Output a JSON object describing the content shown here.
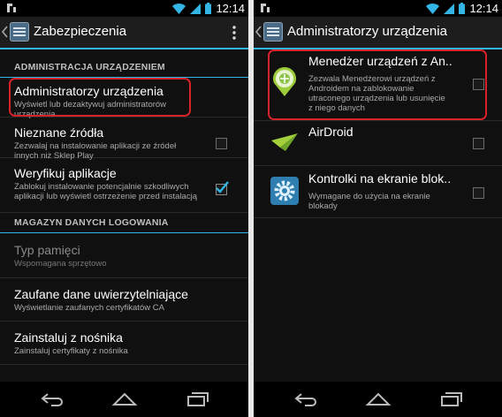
{
  "status": {
    "time": "12:14"
  },
  "left": {
    "title": "Zabezpieczenia",
    "sections": [
      {
        "header": "ADMINISTRACJA URZĄDZENIEM",
        "items": [
          {
            "title": "Administratorzy urządzenia",
            "summary": "Wyświetl lub dezaktywuj administratorów urządzenia"
          },
          {
            "title": "Nieznane źródła",
            "summary": "Zezwalaj na instalowanie aplikacji ze źródeł innych niż Sklep Play",
            "checked": false
          },
          {
            "title": "Weryfikuj aplikacje",
            "summary": "Zablokuj instalowanie potencjalnie szkodliwych aplikacji lub wyświetl ostrzeżenie przed instalacją",
            "checked": true
          }
        ]
      },
      {
        "header": "MAGAZYN DANYCH LOGOWANIA",
        "items": [
          {
            "title": "Typ pamięci",
            "summary": "Wspomagana sprzętowo",
            "disabled": true
          },
          {
            "title": "Zaufane dane uwierzytelniające",
            "summary": "Wyświetlanie zaufanych certyfikatów CA"
          },
          {
            "title": "Zainstaluj z nośnika",
            "summary": "Zainstaluj certyfikaty z nośnika"
          }
        ]
      }
    ]
  },
  "right": {
    "title": "Administratorzy urządzenia",
    "admins": [
      {
        "name": "Menedżer urządzeń z An..",
        "description": "Zezwala Menedżerowi urządzeń z Androidem na zablokowanie utraconego urządzenia lub usunięcie z niego danych",
        "checked": false,
        "icon": "device-manager-icon"
      },
      {
        "name": "AirDroid",
        "description": "",
        "checked": false,
        "icon": "airdroid-icon"
      },
      {
        "name": "Kontrolki na ekranie blok..",
        "description": "Wymagane do użycia na ekranie blokady",
        "checked": false,
        "icon": "settings-gear-icon"
      }
    ]
  },
  "colors": {
    "accent": "#33b5e5",
    "highlight": "#d7222a",
    "background": "#101010"
  }
}
